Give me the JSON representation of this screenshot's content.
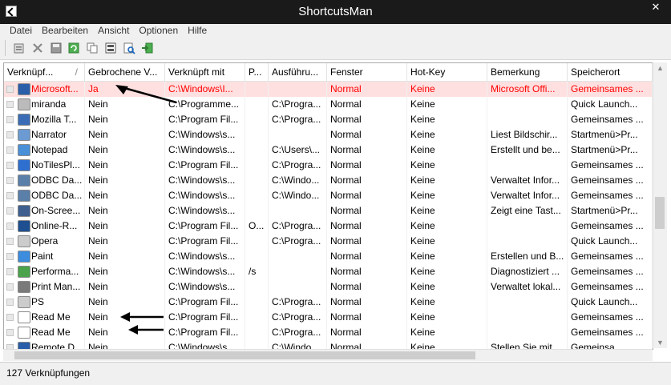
{
  "window": {
    "title": "ShortcutsMan"
  },
  "menu": [
    "Datei",
    "Bearbeiten",
    "Ansicht",
    "Optionen",
    "Hilfe"
  ],
  "toolbar": [
    {
      "name": "properties-icon"
    },
    {
      "name": "delete-icon"
    },
    {
      "name": "save-icon"
    },
    {
      "name": "refresh-icon"
    },
    {
      "name": "copy-icon"
    },
    {
      "name": "html-report-icon"
    },
    {
      "name": "find-icon"
    },
    {
      "name": "exit-icon"
    }
  ],
  "columns": [
    "Verknüpf...",
    "Gebrochene V...",
    "Verknüpft mit",
    "P...",
    "Ausführu...",
    "Fenster",
    "Hot-Key",
    "Bemerkung",
    "Speicherort"
  ],
  "sort_indicator": "/",
  "rows": [
    {
      "cells": [
        "Microsoft...",
        "Ja",
        "C:\\Windows\\I...",
        "",
        "",
        "Normal",
        "Keine",
        "Microsoft Offi...",
        "Gemeinsames ..."
      ],
      "icon": "#2b5ea8",
      "selected": true
    },
    {
      "cells": [
        "miranda",
        "Nein",
        "C:\\Programme...",
        "",
        "C:\\Progra...",
        "Normal",
        "Keine",
        "",
        "Quick Launch..."
      ],
      "icon": "#bbbbbb",
      "selected": false
    },
    {
      "cells": [
        "Mozilla T...",
        "Nein",
        "C:\\Program Fil...",
        "",
        "C:\\Progra...",
        "Normal",
        "Keine",
        "",
        "Gemeinsames ..."
      ],
      "icon": "#3a6db5",
      "selected": false
    },
    {
      "cells": [
        "Narrator",
        "Nein",
        "C:\\Windows\\s...",
        "",
        "",
        "Normal",
        "Keine",
        "Liest Bildschir...",
        "Startmenü>Pr..."
      ],
      "icon": "#6b9bd2",
      "selected": false
    },
    {
      "cells": [
        "Notepad",
        "Nein",
        "C:\\Windows\\s...",
        "",
        "C:\\Users\\...",
        "Normal",
        "Keine",
        "Erstellt und be...",
        "Startmenü>Pr..."
      ],
      "icon": "#4a90d9",
      "selected": false
    },
    {
      "cells": [
        "NoTilesPl...",
        "Nein",
        "C:\\Program Fil...",
        "",
        "C:\\Progra...",
        "Normal",
        "Keine",
        "",
        "Gemeinsames ..."
      ],
      "icon": "#2f6fcf",
      "selected": false
    },
    {
      "cells": [
        "ODBC Da...",
        "Nein",
        "C:\\Windows\\s...",
        "",
        "C:\\Windo...",
        "Normal",
        "Keine",
        "Verwaltet Infor...",
        "Gemeinsames ..."
      ],
      "icon": "#5a7fa8",
      "selected": false
    },
    {
      "cells": [
        "ODBC Da...",
        "Nein",
        "C:\\Windows\\s...",
        "",
        "C:\\Windo...",
        "Normal",
        "Keine",
        "Verwaltet Infor...",
        "Gemeinsames ..."
      ],
      "icon": "#5a7fa8",
      "selected": false
    },
    {
      "cells": [
        "On-Scree...",
        "Nein",
        "C:\\Windows\\s...",
        "",
        "",
        "Normal",
        "Keine",
        "Zeigt eine Tast...",
        "Startmenü>Pr..."
      ],
      "icon": "#3f5f8f",
      "selected": false
    },
    {
      "cells": [
        "Online-R...",
        "Nein",
        "C:\\Program Fil...",
        "O...",
        "C:\\Progra...",
        "Normal",
        "Keine",
        "",
        "Gemeinsames ..."
      ],
      "icon": "#1d4f91",
      "selected": false
    },
    {
      "cells": [
        "Opera",
        "Nein",
        "C:\\Program Fil...",
        "",
        "C:\\Progra...",
        "Normal",
        "Keine",
        "",
        "Quick Launch..."
      ],
      "icon": "#cccccc",
      "selected": false
    },
    {
      "cells": [
        "Paint",
        "Nein",
        "C:\\Windows\\s...",
        "",
        "",
        "Normal",
        "Keine",
        "Erstellen und B...",
        "Gemeinsames ..."
      ],
      "icon": "#3c8dde",
      "selected": false
    },
    {
      "cells": [
        "Performa...",
        "Nein",
        "C:\\Windows\\s...",
        "/s",
        "",
        "Normal",
        "Keine",
        "Diagnostiziert ...",
        "Gemeinsames ..."
      ],
      "icon": "#4aa34a",
      "selected": false
    },
    {
      "cells": [
        "Print Man...",
        "Nein",
        "C:\\Windows\\s...",
        "",
        "",
        "Normal",
        "Keine",
        "Verwaltet lokal...",
        "Gemeinsames ..."
      ],
      "icon": "#7a7a7a",
      "selected": false
    },
    {
      "cells": [
        "PS",
        "Nein",
        "C:\\Program Fil...",
        "",
        "C:\\Progra...",
        "Normal",
        "Keine",
        "",
        "Quick Launch..."
      ],
      "icon": "#cccccc",
      "selected": false
    },
    {
      "cells": [
        "Read Me",
        "Nein",
        "C:\\Program Fil...",
        "",
        "C:\\Progra...",
        "Normal",
        "Keine",
        "",
        "Gemeinsames ..."
      ],
      "icon": "#ffffff",
      "selected": false
    },
    {
      "cells": [
        "Read Me",
        "Nein",
        "C:\\Program Fil...",
        "",
        "C:\\Progra...",
        "Normal",
        "Keine",
        "",
        "Gemeinsames ..."
      ],
      "icon": "#ffffff",
      "selected": false
    },
    {
      "cells": [
        "Remote D...",
        "Nein",
        "C:\\Windows\\s...",
        "",
        "C:\\Windo...",
        "Normal",
        "Keine",
        "Stellen Sie mit...",
        "Gemeinsa..."
      ],
      "icon": "#2b5ea8",
      "selected": false
    }
  ],
  "status": {
    "count_text": "127 Verknüpfungen"
  }
}
